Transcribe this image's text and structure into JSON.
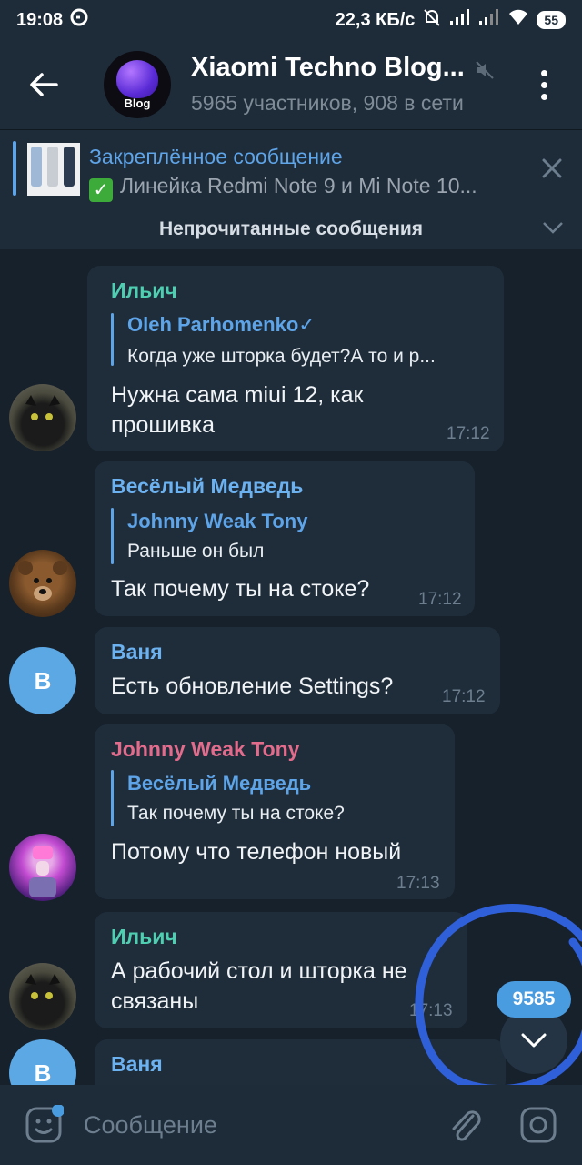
{
  "status_bar": {
    "time": "19:08",
    "network_speed": "22,3 КБ/с",
    "battery": "55"
  },
  "header": {
    "avatar_text": "Blog",
    "title": "Xiaomi Techno Blog...",
    "subtitle": "5965 участников, 908 в сети"
  },
  "pinned": {
    "title": "Закреплённое сообщение",
    "text": "Линейка Redmi Note 9 и Mi Note 10..."
  },
  "unread_banner": "Непрочитанные сообщения",
  "messages": [
    {
      "sender": "Ильич",
      "sender_color": "#4fcfb1",
      "reply_name": "Oleh Parhomenko✓",
      "reply_text": "Когда уже шторка будет?А то и р...",
      "text_line1": "Нужна сама miui 12, как",
      "text_line2": "прошивка",
      "time": "17:12"
    },
    {
      "sender": "Весёлый Медведь",
      "sender_color": "#6cb2f0",
      "reply_name": "Johnny Weak Tony",
      "reply_text": "Раньше он был",
      "text": "Так почему ты на стоке?",
      "time": "17:12"
    },
    {
      "sender": "Ваня",
      "sender_color": "#6cb2f0",
      "avatar_letter": "В",
      "text": "Есть обновление Settings?",
      "time": "17:12"
    },
    {
      "sender": "Johnny Weak Tony",
      "sender_color": "#e36b8c",
      "reply_name": "Весёлый Медведь",
      "reply_text": "Так почему ты на стоке?",
      "text": "Потому что телефон новый",
      "time": "17:13"
    },
    {
      "sender": "Ильич",
      "sender_color": "#4fcfb1",
      "text_line1": "А рабочий стол и шторка не",
      "text_line2": "связаны",
      "time": "17:13"
    },
    {
      "sender": "Ваня",
      "sender_color": "#6cb2f0",
      "avatar_letter": "В"
    }
  ],
  "scroll": {
    "unread_count": "9585"
  },
  "composer": {
    "placeholder": "Сообщение"
  },
  "colors": {
    "background": "#17212b",
    "header": "#1e2b38",
    "bubble": "#1f2d3b",
    "accent": "#5ea4e8",
    "annotation": "#2f5fd9"
  }
}
